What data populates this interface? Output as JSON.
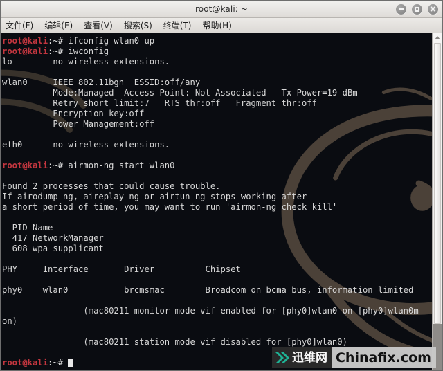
{
  "window": {
    "title": "root@kali: ~",
    "buttons": {
      "minimize": "minimize",
      "maximize": "maximize",
      "close": "close"
    }
  },
  "menubar": {
    "items": [
      {
        "label": "文件(F)"
      },
      {
        "label": "编辑(E)"
      },
      {
        "label": "查看(V)"
      },
      {
        "label": "搜索(S)"
      },
      {
        "label": "终端(T)"
      },
      {
        "label": "帮助(H)"
      }
    ]
  },
  "terminal": {
    "prompt_host": "root@kali",
    "prompt_sep": ":~#",
    "colors": {
      "background": "#0a0c11",
      "foreground": "#d7d7d7",
      "prompt_red": "#c3363f",
      "dragon": "#4a4038"
    },
    "lines": [
      {
        "type": "prompt",
        "command": " ifconfig wlan0 up"
      },
      {
        "type": "prompt",
        "command": " iwconfig"
      },
      {
        "type": "out",
        "text": "lo        no wireless extensions."
      },
      {
        "type": "out",
        "text": ""
      },
      {
        "type": "out",
        "text": "wlan0     IEEE 802.11bgn  ESSID:off/any"
      },
      {
        "type": "out",
        "text": "          Mode:Managed  Access Point: Not-Associated   Tx-Power=19 dBm"
      },
      {
        "type": "out",
        "text": "          Retry short limit:7   RTS thr:off   Fragment thr:off"
      },
      {
        "type": "out",
        "text": "          Encryption key:off"
      },
      {
        "type": "out",
        "text": "          Power Management:off"
      },
      {
        "type": "out",
        "text": ""
      },
      {
        "type": "out",
        "text": "eth0      no wireless extensions."
      },
      {
        "type": "out",
        "text": ""
      },
      {
        "type": "prompt",
        "command": " airmon-ng start wlan0"
      },
      {
        "type": "out",
        "text": ""
      },
      {
        "type": "out",
        "text": "Found 2 processes that could cause trouble."
      },
      {
        "type": "out",
        "text": "If airodump-ng, aireplay-ng or airtun-ng stops working after"
      },
      {
        "type": "out",
        "text": "a short period of time, you may want to run 'airmon-ng check kill'"
      },
      {
        "type": "out",
        "text": ""
      },
      {
        "type": "out",
        "text": "  PID Name"
      },
      {
        "type": "out",
        "text": "  417 NetworkManager"
      },
      {
        "type": "out",
        "text": "  608 wpa_supplicant"
      },
      {
        "type": "out",
        "text": ""
      },
      {
        "type": "out",
        "text": "PHY     Interface       Driver          Chipset"
      },
      {
        "type": "out",
        "text": ""
      },
      {
        "type": "out",
        "text": "phy0    wlan0           brcmsmac        Broadcom on bcma bus, information limited"
      },
      {
        "type": "out",
        "text": ""
      },
      {
        "type": "out",
        "text": "                (mac80211 monitor mode vif enabled for [phy0]wlan0 on [phy0]wlan0m"
      },
      {
        "type": "out",
        "text": "on)"
      },
      {
        "type": "out",
        "text": ""
      },
      {
        "type": "out",
        "text": "                (mac80211 station mode vif disabled for [phy0]wlan0)"
      },
      {
        "type": "out",
        "text": ""
      },
      {
        "type": "cursor",
        "command": " "
      }
    ]
  },
  "scrollbar": {
    "up_arrow": "scroll-up"
  },
  "watermark": {
    "chinese": "迅维网",
    "english": "Chinafix.com",
    "chevron_color": "#14b8a6"
  }
}
